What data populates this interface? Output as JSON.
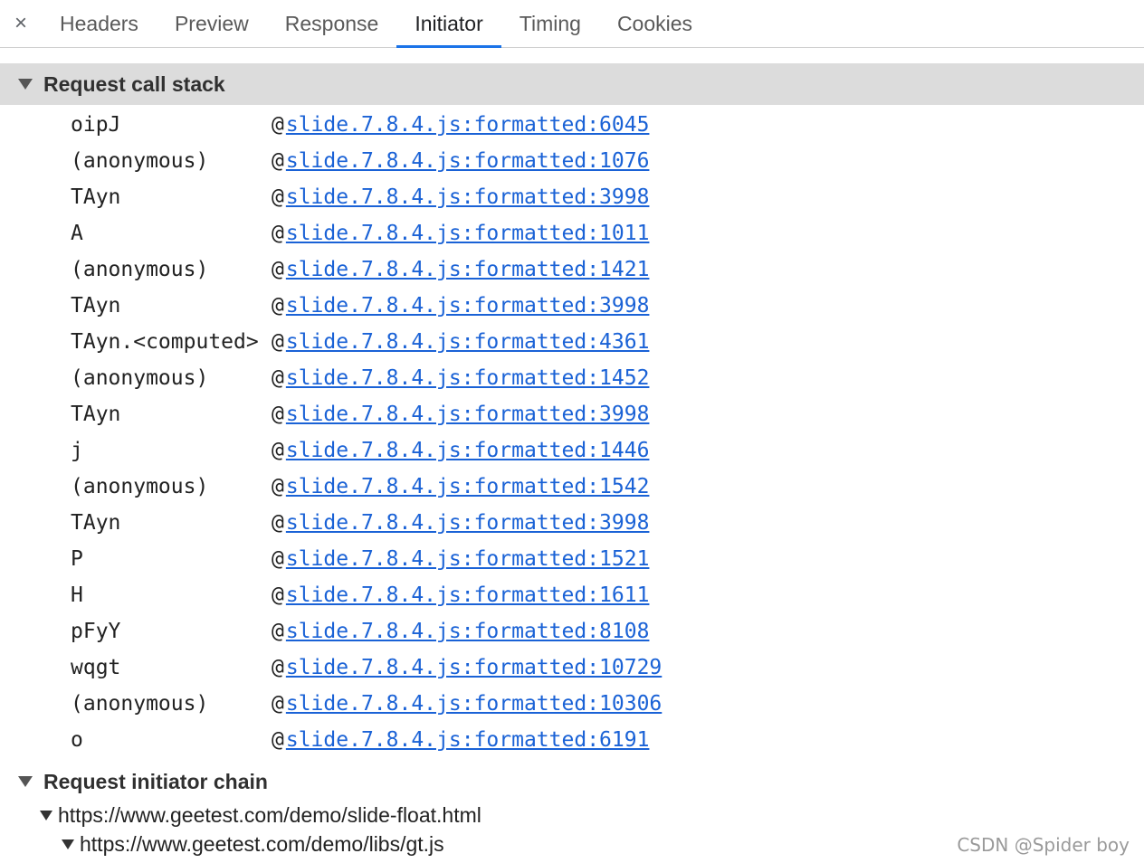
{
  "tabs": {
    "close_label": "×",
    "items": [
      {
        "label": "Headers",
        "active": false
      },
      {
        "label": "Preview",
        "active": false
      },
      {
        "label": "Response",
        "active": false
      },
      {
        "label": "Initiator",
        "active": true
      },
      {
        "label": "Cookies",
        "active": false
      }
    ],
    "timing_label": "Timing"
  },
  "call_stack": {
    "title": "Request call stack",
    "at_symbol": "@",
    "frames": [
      {
        "fn": "oipJ",
        "location": "slide.7.8.4.js:formatted:6045"
      },
      {
        "fn": "(anonymous)",
        "location": "slide.7.8.4.js:formatted:1076"
      },
      {
        "fn": "TAyn",
        "location": "slide.7.8.4.js:formatted:3998"
      },
      {
        "fn": "A",
        "location": "slide.7.8.4.js:formatted:1011"
      },
      {
        "fn": "(anonymous)",
        "location": "slide.7.8.4.js:formatted:1421"
      },
      {
        "fn": "TAyn",
        "location": "slide.7.8.4.js:formatted:3998"
      },
      {
        "fn": "TAyn.<computed>",
        "location": "slide.7.8.4.js:formatted:4361"
      },
      {
        "fn": "(anonymous)",
        "location": "slide.7.8.4.js:formatted:1452"
      },
      {
        "fn": "TAyn",
        "location": "slide.7.8.4.js:formatted:3998"
      },
      {
        "fn": "j",
        "location": "slide.7.8.4.js:formatted:1446"
      },
      {
        "fn": "(anonymous)",
        "location": "slide.7.8.4.js:formatted:1542"
      },
      {
        "fn": "TAyn",
        "location": "slide.7.8.4.js:formatted:3998"
      },
      {
        "fn": "P",
        "location": "slide.7.8.4.js:formatted:1521"
      },
      {
        "fn": "H",
        "location": "slide.7.8.4.js:formatted:1611"
      },
      {
        "fn": "pFyY",
        "location": "slide.7.8.4.js:formatted:8108"
      },
      {
        "fn": "wqgt",
        "location": "slide.7.8.4.js:formatted:10729"
      },
      {
        "fn": "(anonymous)",
        "location": "slide.7.8.4.js:formatted:10306"
      },
      {
        "fn": "o",
        "location": "slide.7.8.4.js:formatted:6191"
      }
    ]
  },
  "initiator_chain": {
    "title": "Request initiator chain",
    "items": [
      {
        "url": "https://www.geetest.com/demo/slide-float.html"
      },
      {
        "url": "https://www.geetest.com/demo/libs/gt.js"
      }
    ]
  },
  "watermark": "CSDN @Spider boy",
  "colors": {
    "accent": "#1a73e8",
    "link": "#1a62d6",
    "section_header_bg": "#dcdcdc"
  }
}
